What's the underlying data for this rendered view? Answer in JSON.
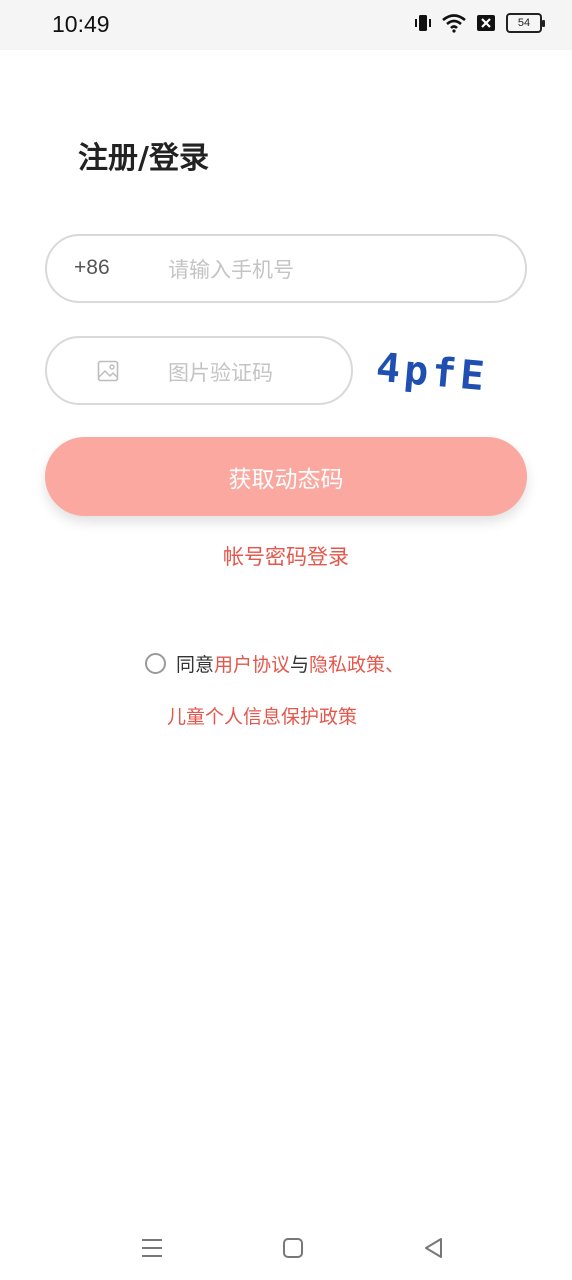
{
  "status_bar": {
    "time": "10:49",
    "battery": "54",
    "icons": [
      "vibrate-icon",
      "wifi-icon",
      "sim-off-icon",
      "battery-icon"
    ]
  },
  "page": {
    "title": "注册/登录"
  },
  "phone": {
    "prefix": "+86",
    "placeholder": "请输入手机号",
    "value": ""
  },
  "captcha": {
    "placeholder": "图片验证码",
    "value": "",
    "image_text": "4pfE",
    "icon": "image-icon"
  },
  "actions": {
    "get_code_label": "获取动态码",
    "password_login_label": "帐号密码登录"
  },
  "agreement": {
    "prefix": "同意",
    "user_agreement": "用户协议",
    "and": "与",
    "privacy_policy": "隐私政策",
    "separator": "、",
    "children_policy": "儿童个人信息保护政策"
  },
  "colors": {
    "accent": "#e4574c",
    "button_bg": "#fba8a0",
    "captcha_text": "#1f4fb0"
  },
  "nav": {
    "icons": [
      "menu-icon",
      "home-icon",
      "back-icon"
    ]
  }
}
